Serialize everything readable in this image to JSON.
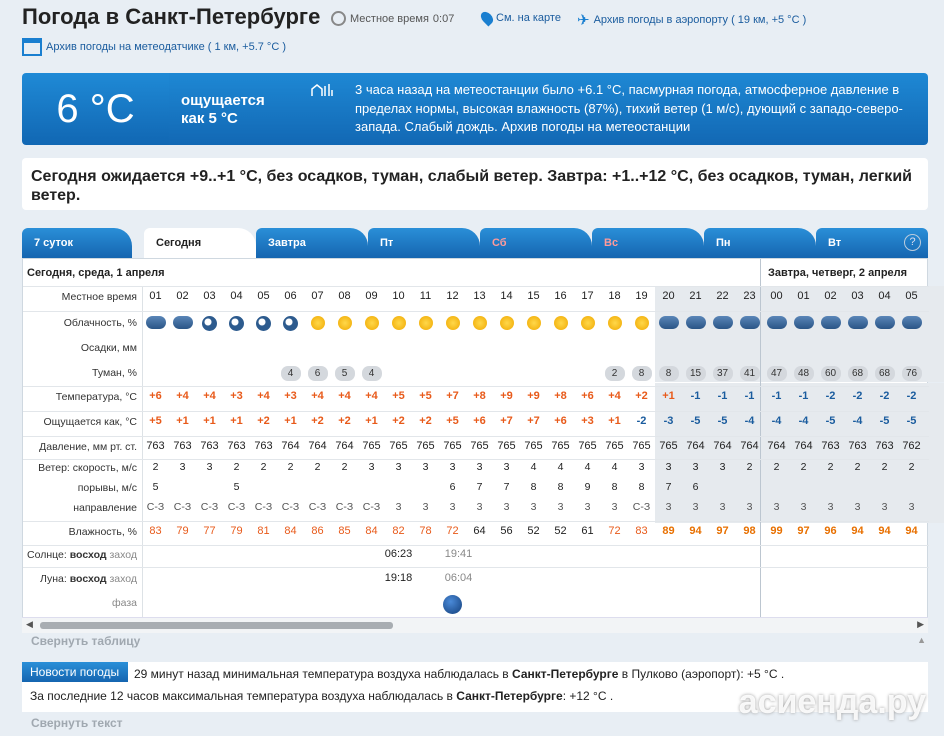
{
  "header": {
    "title": "Погода в Санкт-Петербурге",
    "local_time_label": "Местное время",
    "local_time": "0:07",
    "map_link": "См. на карте",
    "airport_link": "Архив погоды в аэропорту ( 19 км, +5 °C )",
    "station_link": "Архив погоды на метеодатчике ( 1 км, +5.7 °C )"
  },
  "current": {
    "temp": "6 °C",
    "feels_line1": "ощущается",
    "feels_line2": "как 5 °C",
    "description": "3 часа назад на метеостанции было +6.1 °C, пасмурная погода, атмосферное давление в пределах нормы, высокая влажность (87%), тихий ветер (1 м/с), дующий с западо-северо-запада. Слабый дождь. Архив погоды на метеостанции"
  },
  "forecast_text": "Сегодня ожидается +9..+1 °C, без осадков, туман, слабый ветер. Завтра: +1..+12 °C, без осадков, туман, легкий ветер.",
  "tabs": [
    {
      "label": "7 суток"
    },
    {
      "label": "Сегодня"
    },
    {
      "label": "Завтра"
    },
    {
      "label": "Пт"
    },
    {
      "label": "Сб"
    },
    {
      "label": "Вс"
    },
    {
      "label": "Пн"
    },
    {
      "label": "Вт"
    }
  ],
  "help_label": "?",
  "table": {
    "day1": "Сегодня, среда, 1 апреля",
    "day2": "Завтра, четверг, 2 апреля",
    "row_labels": {
      "time": "Местное время",
      "cloud": "Облачность, %",
      "precip": "Осадки, мм",
      "fog": "Туман, %",
      "temp": "Температура, °C",
      "feels": "Ощущается как, °C",
      "pressure": "Давление, мм рт. ст.",
      "wind_speed": "Ветер: скорость, м/с",
      "gusts": "порывы, м/с",
      "direction": "направление",
      "humidity": "Влажность, %",
      "sun_label": "Солнце:",
      "sunrise": "восход",
      "sunset": "заход",
      "moon_label": "Луна:",
      "moonrise": "восход",
      "moonset": "заход",
      "phase": "фаза"
    },
    "hours": [
      "01",
      "02",
      "03",
      "04",
      "05",
      "06",
      "07",
      "08",
      "09",
      "10",
      "11",
      "12",
      "13",
      "14",
      "15",
      "16",
      "17",
      "18",
      "19",
      "20",
      "21",
      "22",
      "23",
      "00",
      "01",
      "02",
      "03",
      "04",
      "05"
    ],
    "cloud": [
      "cm",
      "cm",
      "m",
      "m",
      "m",
      "m",
      "s",
      "s",
      "sc",
      "sc",
      "sc",
      "s",
      "s",
      "s",
      "s",
      "s",
      "s",
      "s",
      "sc",
      "c",
      "c",
      "c",
      "c",
      "c",
      "c",
      "c",
      "c",
      "c",
      "c"
    ],
    "fog": [
      "",
      "",
      "",
      "",
      "",
      "4",
      "6",
      "5",
      "4",
      "",
      "",
      "",
      "",
      "",
      "",
      "",
      "",
      "2",
      "8",
      "8",
      "15",
      "37",
      "41",
      "47",
      "48",
      "60",
      "68",
      "68",
      "76"
    ],
    "temp": [
      "+6",
      "+4",
      "+4",
      "+3",
      "+4",
      "+3",
      "+4",
      "+4",
      "+4",
      "+5",
      "+5",
      "+7",
      "+8",
      "+9",
      "+9",
      "+8",
      "+6",
      "+4",
      "+2",
      "+1",
      "-1",
      "-1",
      "-1",
      "-1",
      "-1",
      "-2",
      "-2",
      "-2",
      "-2"
    ],
    "feels": [
      "+5",
      "+1",
      "+1",
      "+1",
      "+2",
      "+1",
      "+2",
      "+2",
      "+1",
      "+2",
      "+2",
      "+5",
      "+6",
      "+7",
      "+7",
      "+6",
      "+3",
      "+1",
      "-2",
      "-3",
      "-5",
      "-5",
      "-4",
      "-4",
      "-4",
      "-5",
      "-4",
      "-5",
      "-5"
    ],
    "pressure": [
      "763",
      "763",
      "763",
      "763",
      "763",
      "764",
      "764",
      "764",
      "765",
      "765",
      "765",
      "765",
      "765",
      "765",
      "765",
      "765",
      "765",
      "765",
      "765",
      "765",
      "764",
      "764",
      "764",
      "764",
      "764",
      "763",
      "763",
      "763",
      "762"
    ],
    "wind": [
      "2",
      "3",
      "3",
      "2",
      "2",
      "2",
      "2",
      "2",
      "3",
      "3",
      "3",
      "3",
      "3",
      "3",
      "4",
      "4",
      "4",
      "4",
      "3",
      "3",
      "3",
      "3",
      "2",
      "2",
      "2",
      "2",
      "2",
      "2",
      "2"
    ],
    "gusts": [
      "5",
      "",
      "",
      "5",
      "",
      "",
      "",
      "",
      "",
      "",
      "",
      "6",
      "7",
      "7",
      "8",
      "8",
      "9",
      "8",
      "8",
      "7",
      "6",
      "",
      "",
      "",
      "",
      "",
      "",
      "",
      ""
    ],
    "dir": [
      "С-З",
      "С-З",
      "С-З",
      "С-З",
      "С-З",
      "С-З",
      "С-З",
      "С-З",
      "С-З",
      "3",
      "3",
      "3",
      "3",
      "3",
      "3",
      "3",
      "3",
      "3",
      "С-З",
      "3",
      "3",
      "3",
      "3",
      "3",
      "3",
      "3",
      "3",
      "3",
      "3"
    ],
    "humidity": [
      "83",
      "79",
      "77",
      "79",
      "81",
      "84",
      "86",
      "85",
      "84",
      "82",
      "78",
      "72",
      "64",
      "56",
      "52",
      "52",
      "61",
      "72",
      "83",
      "89",
      "94",
      "97",
      "98",
      "99",
      "97",
      "96",
      "94",
      "94",
      "94"
    ],
    "sunrise": "06:23",
    "sunset": "19:41",
    "moonrise": "19:18",
    "moonset": "06:04"
  },
  "collapse_table": "Свернуть таблицу",
  "news": {
    "tag": "Новости погоды",
    "line1_pre": "29 минут назад минимальная температура воздуха наблюдалась в",
    "line1_city": "Санкт-Петербурге",
    "line1_post": "в Пулково (аэропорт): +5 °С .",
    "line2_pre": "За последние 12 часов максимальная температура воздуха наблюдалась в",
    "line2_city": "Санкт-Петербурге",
    "line2_post": ": +12 °С ."
  },
  "collapse_text": "Свернуть текст",
  "watermark": "асиенда.ру"
}
